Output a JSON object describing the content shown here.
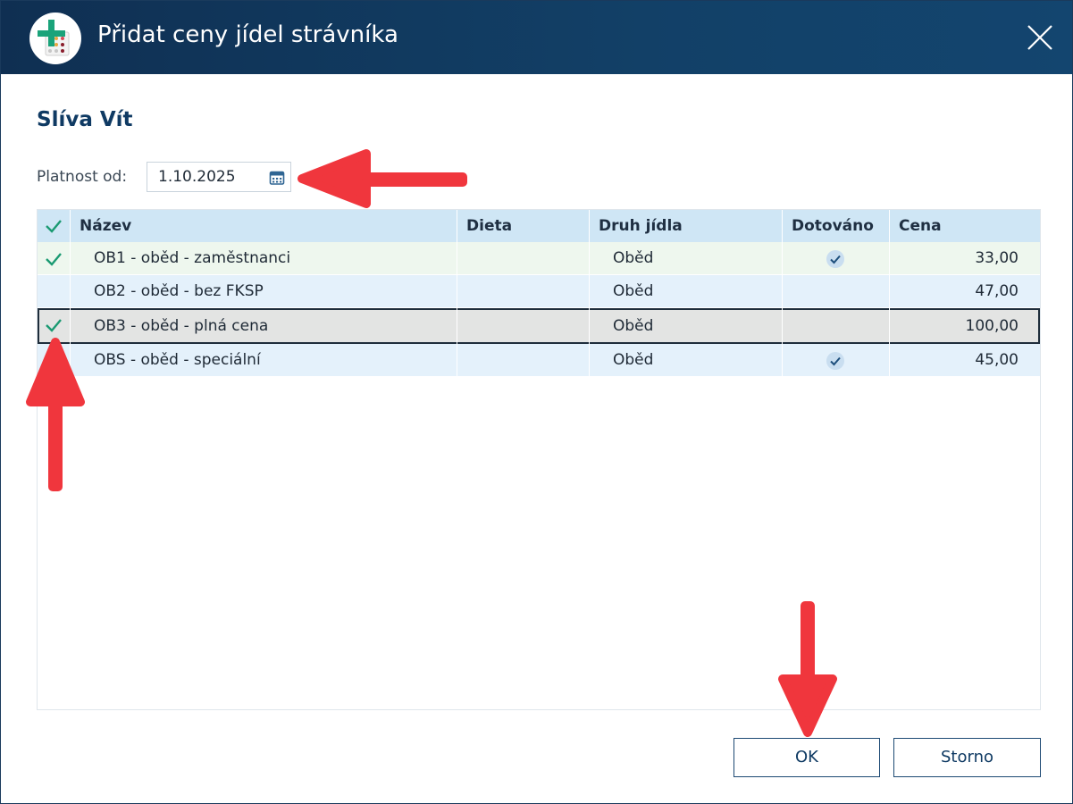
{
  "window": {
    "title": "Přidat ceny jídel strávníka",
    "app_logo_icon": "calendar-plus-logo-icon",
    "close_icon": "close-icon"
  },
  "person": {
    "name": "Slíva Vít"
  },
  "validity": {
    "label": "Platnost od:",
    "value": "1.10.2025",
    "icon": "calendar-icon"
  },
  "grid": {
    "columns": [
      "Název",
      "Dieta",
      "Druh jídla",
      "Dotováno",
      "Cena"
    ],
    "rows": [
      {
        "checked": true,
        "name": "OB1 - oběd - zaměstnanci",
        "dieta": "",
        "druh": "Oběd",
        "dotovano": true,
        "cena": "33,00"
      },
      {
        "checked": false,
        "name": "OB2 - oběd - bez FKSP",
        "dieta": "",
        "druh": "Oběd",
        "dotovano": false,
        "cena": "47,00"
      },
      {
        "checked": true,
        "name": "OB3 - oběd - plná cena",
        "dieta": "",
        "druh": "Oběd",
        "dotovano": false,
        "cena": "100,00"
      },
      {
        "checked": false,
        "name": "OBS - oběd - speciální",
        "dieta": "",
        "druh": "Oběd",
        "dotovano": true,
        "cena": "45,00"
      }
    ]
  },
  "buttons": {
    "ok": "OK",
    "cancel": "Storno"
  },
  "colors": {
    "titlebar": "#124067",
    "accent_check": "#1a9a72",
    "header_bg": "#cfe6f5",
    "annotation_arrow": "#f0363d"
  }
}
